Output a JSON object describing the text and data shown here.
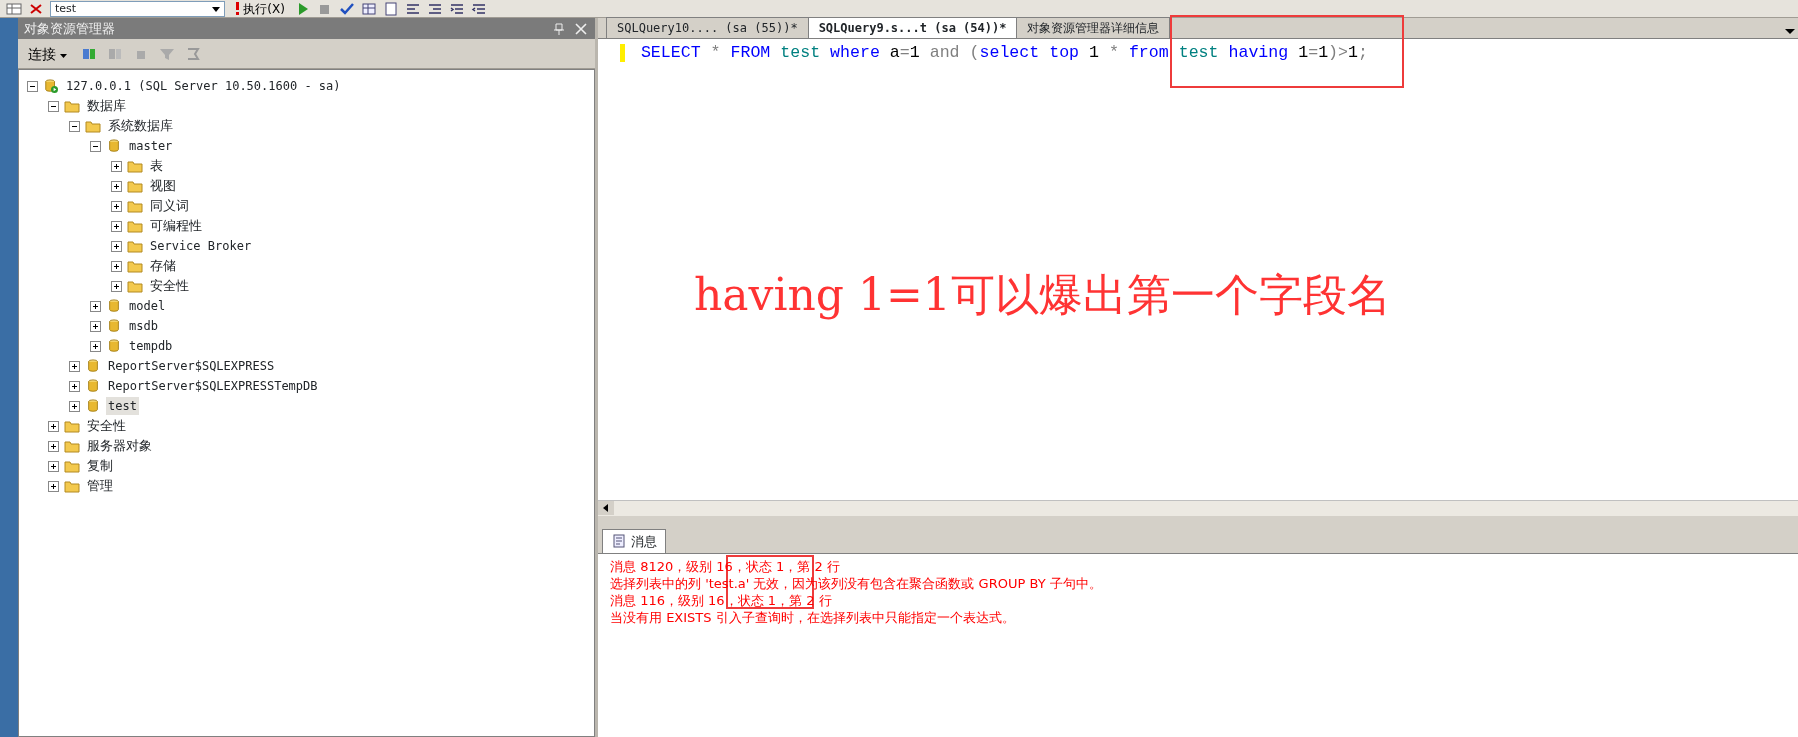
{
  "toolbar": {
    "database": "test",
    "execute_label": "执行(X)"
  },
  "object_explorer": {
    "title": "对象资源管理器",
    "connect_label": "连接",
    "tree": [
      {
        "label": "127.0.0.1 (SQL Server 10.50.1600 - sa)",
        "kind": "server",
        "expanded": true,
        "selected": false,
        "children": [
          {
            "label": "数据库",
            "kind": "folder",
            "expanded": true,
            "selected": false,
            "children": [
              {
                "label": "系统数据库",
                "kind": "folder",
                "expanded": true,
                "selected": false,
                "children": [
                  {
                    "label": "master",
                    "kind": "database",
                    "expanded": true,
                    "selected": false,
                    "children": [
                      {
                        "label": "表",
                        "kind": "folder",
                        "expanded": false,
                        "selected": false
                      },
                      {
                        "label": "视图",
                        "kind": "folder",
                        "expanded": false,
                        "selected": false
                      },
                      {
                        "label": "同义词",
                        "kind": "folder",
                        "expanded": false,
                        "selected": false
                      },
                      {
                        "label": "可编程性",
                        "kind": "folder",
                        "expanded": false,
                        "selected": false
                      },
                      {
                        "label": "Service Broker",
                        "kind": "folder",
                        "expanded": false,
                        "selected": false
                      },
                      {
                        "label": "存储",
                        "kind": "folder",
                        "expanded": false,
                        "selected": false
                      },
                      {
                        "label": "安全性",
                        "kind": "folder",
                        "expanded": false,
                        "selected": false
                      }
                    ]
                  },
                  {
                    "label": "model",
                    "kind": "database",
                    "expanded": false,
                    "selected": false
                  },
                  {
                    "label": "msdb",
                    "kind": "database",
                    "expanded": false,
                    "selected": false
                  },
                  {
                    "label": "tempdb",
                    "kind": "database",
                    "expanded": false,
                    "selected": false
                  }
                ]
              },
              {
                "label": "ReportServer$SQLEXPRESS",
                "kind": "database",
                "expanded": false,
                "selected": false
              },
              {
                "label": "ReportServer$SQLEXPRESSTempDB",
                "kind": "database",
                "expanded": false,
                "selected": false
              },
              {
                "label": "test",
                "kind": "database",
                "expanded": false,
                "selected": true
              }
            ]
          },
          {
            "label": "安全性",
            "kind": "folder",
            "expanded": false,
            "selected": false
          },
          {
            "label": "服务器对象",
            "kind": "folder",
            "expanded": false,
            "selected": false
          },
          {
            "label": "复制",
            "kind": "folder",
            "expanded": false,
            "selected": false
          },
          {
            "label": "管理",
            "kind": "folder",
            "expanded": false,
            "selected": false
          }
        ]
      }
    ]
  },
  "tabs": [
    {
      "label": "SQLQuery10.... (sa (55))*",
      "selected": false
    },
    {
      "label": "SQLQuery9.s...t (sa (54))*",
      "selected": true
    },
    {
      "label": "对象资源管理器详细信息",
      "selected": false
    }
  ],
  "query_tokens": [
    {
      "text": "SELECT",
      "kind": "keyword"
    },
    {
      "text": " * ",
      "kind": "operator"
    },
    {
      "text": "FROM",
      "kind": "keyword"
    },
    {
      "text": " test ",
      "kind": "object"
    },
    {
      "text": "where",
      "kind": "keyword"
    },
    {
      "text": " a",
      "kind": "plain"
    },
    {
      "text": "=",
      "kind": "operator"
    },
    {
      "text": "1 ",
      "kind": "plain"
    },
    {
      "text": "and (",
      "kind": "operator"
    },
    {
      "text": "select top",
      "kind": "keyword"
    },
    {
      "text": " 1 ",
      "kind": "plain"
    },
    {
      "text": "* ",
      "kind": "operator"
    },
    {
      "text": "from",
      "kind": "keyword"
    },
    {
      "text": " test ",
      "kind": "object"
    },
    {
      "text": "having",
      "kind": "keyword"
    },
    {
      "text": " 1",
      "kind": "plain"
    },
    {
      "text": "=",
      "kind": "operator"
    },
    {
      "text": "1",
      "kind": "plain"
    },
    {
      "text": ")>",
      "kind": "operator"
    },
    {
      "text": "1",
      "kind": "plain"
    },
    {
      "text": ";",
      "kind": "operator"
    }
  ],
  "annotation": "having 1=1可以爆出第一个字段名",
  "results": {
    "tab_label": "消息",
    "messages": [
      "消息 8120，级别 16，状态 1，第 2 行",
      "选择列表中的列 'test.a' 无效，因为该列没有包含在聚合函数或 GROUP BY 子句中。",
      "消息 116，级别 16，状态 1，第 2 行",
      "当没有用 EXISTS 引入子查询时，在选择列表中只能指定一个表达式。"
    ]
  }
}
